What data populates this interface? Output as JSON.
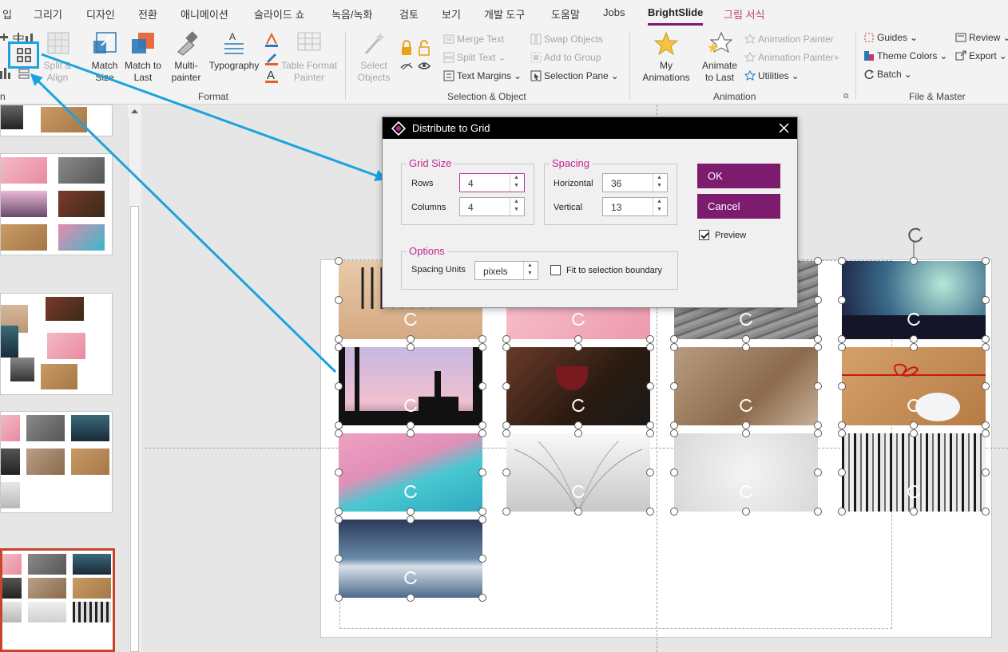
{
  "tabs": [
    "입",
    "그리기",
    "디자인",
    "전환",
    "애니메이션",
    "슬라이드 쇼",
    "녹음/녹화",
    "검토",
    "보기",
    "개발 도구",
    "도움말",
    "Jobs",
    "BrightSlide",
    "그림 서식"
  ],
  "ribbon": {
    "format": {
      "split_align": "Split &\nAlign",
      "match_to_size": "Match\nSize",
      "match_to_last": "Match to\nLast",
      "multipainter": "Multi-\npainter",
      "typography": "Typography",
      "table_format_painter": "Table Format\nPainter",
      "label": "Format"
    },
    "selection": {
      "select_objects": "Select\nObjects",
      "merge_text": "Merge Text",
      "split_text": "Split Text",
      "text_margins": "Text Margins",
      "swap_objects": "Swap Objects",
      "add_to_group": "Add to Group",
      "selection_pane": "Selection Pane",
      "label": "Selection & Object"
    },
    "animation": {
      "my_animations": "My\nAnimations",
      "animate_to_last": "Animate\nto Last",
      "animation_painter": "Animation Painter",
      "animation_painter_plus": "Animation Painter+",
      "utilities": "Utilities",
      "label": "Animation"
    },
    "file_master": {
      "guides": "Guides",
      "theme_colors": "Theme Colors",
      "batch": "Batch",
      "review": "Review",
      "export": "Export",
      "label": "File & Master"
    },
    "left_label": "n"
  },
  "dialog": {
    "title": "Distribute to Grid",
    "grid_size": {
      "legend": "Grid Size",
      "rows_label": "Rows",
      "rows_value": "4",
      "columns_label": "Columns",
      "columns_value": "4"
    },
    "spacing": {
      "legend": "Spacing",
      "horizontal_label": "Horizontal",
      "horizontal_value": "36",
      "vertical_label": "Vertical",
      "vertical_value": "13"
    },
    "options": {
      "legend": "Options",
      "spacing_units_label": "Spacing Units",
      "spacing_units_value": "pixels",
      "fit_label": "Fit to selection boundary",
      "fit_checked": false
    },
    "ok": "OK",
    "cancel": "Cancel",
    "preview_label": "Preview",
    "preview_checked": true
  },
  "colors": {
    "accent": "#7d1b6e",
    "legend": "#c2248f",
    "annotation_arrow": "#1aa3e0",
    "highlight_box": "#1aa3e0",
    "selected_slide_border": "#c8452a"
  }
}
